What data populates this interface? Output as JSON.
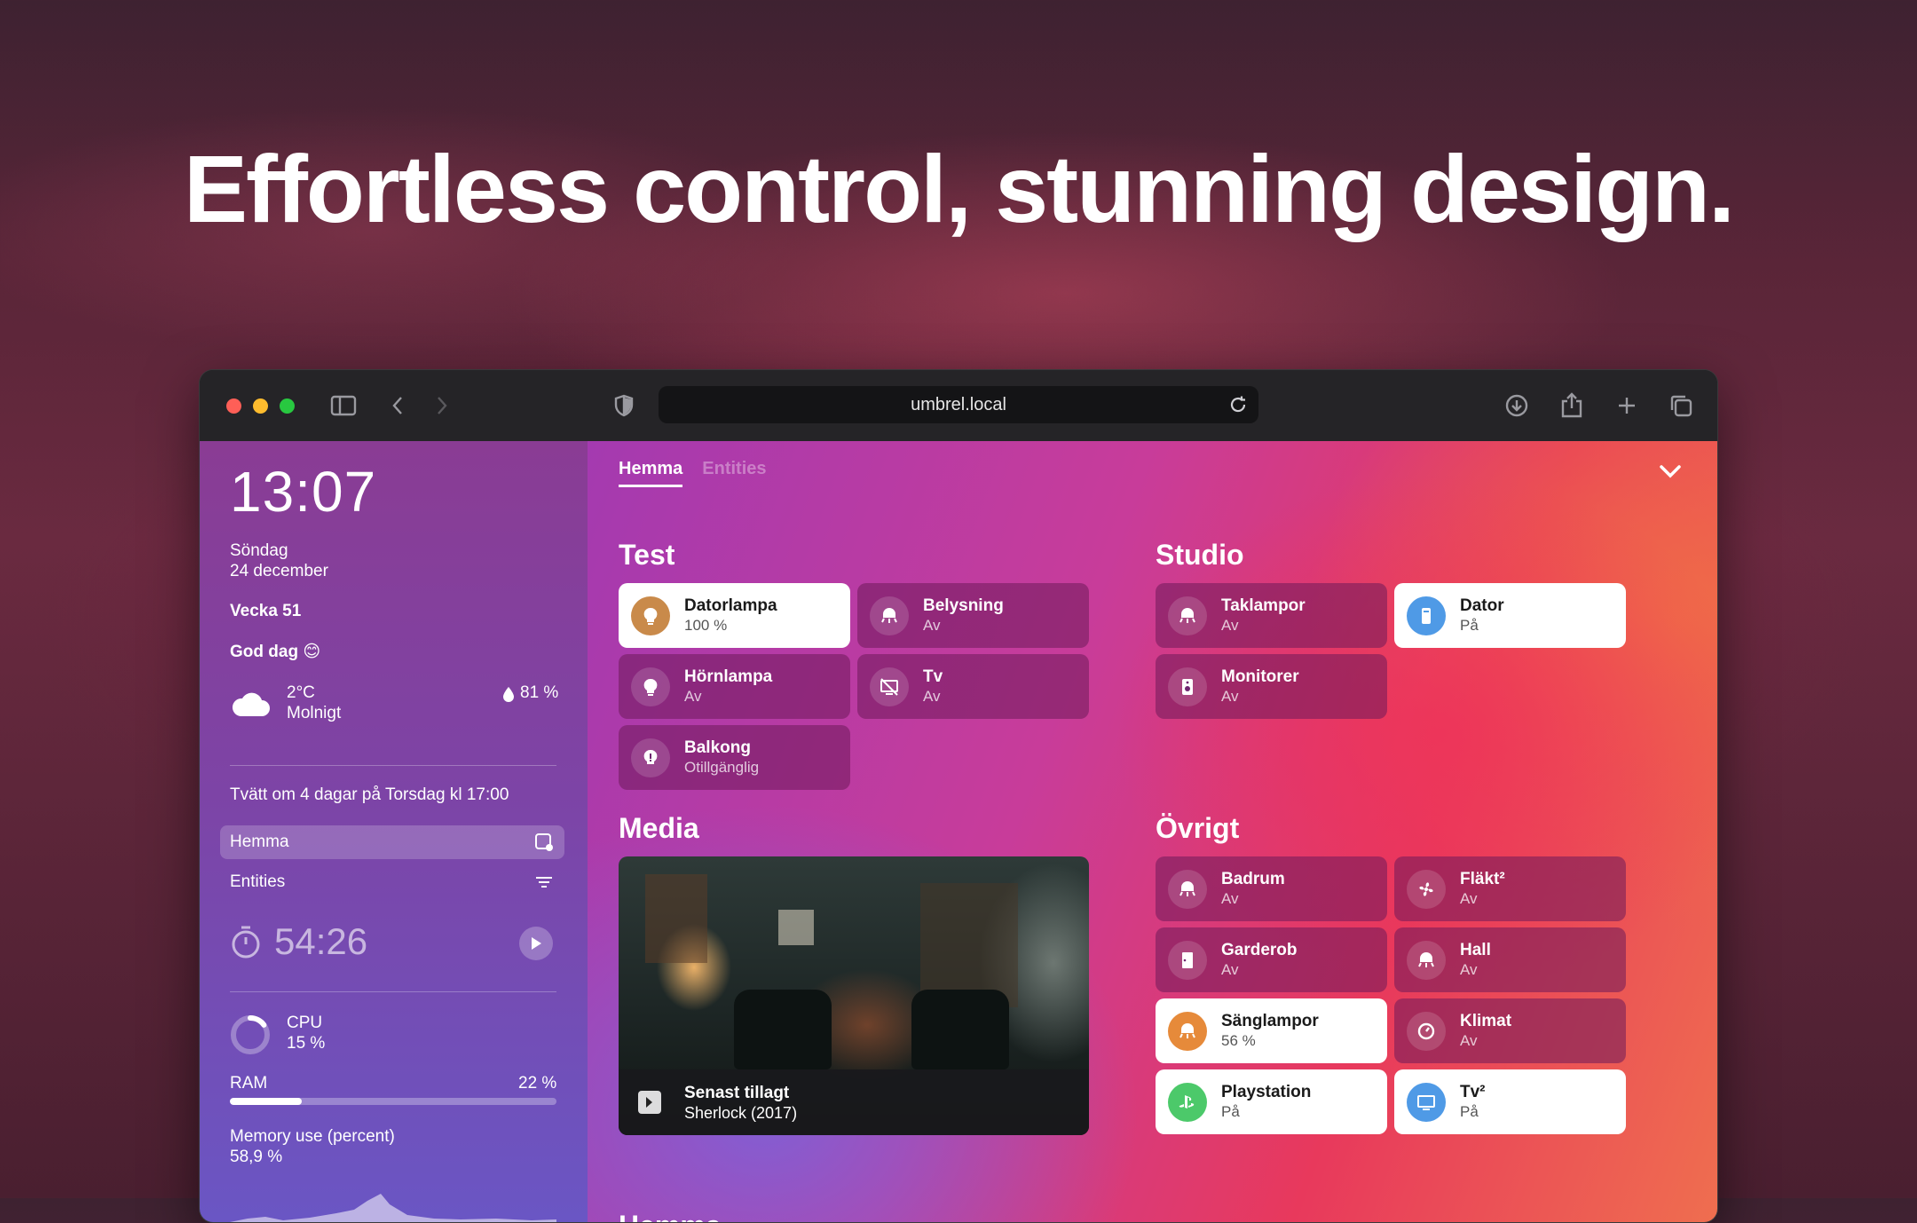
{
  "headline": "Effortless control, stunning design.",
  "browser": {
    "url": "umbrel.local"
  },
  "sidebar": {
    "time": "13:07",
    "weekday": "Söndag",
    "date": "24 december",
    "week": "Vecka 51",
    "greeting": "God dag 😊",
    "weather": {
      "temp": "2°C",
      "condition": "Molnigt",
      "humidity": "81 %"
    },
    "reminder": "Tvätt om 4 dagar på Torsdag kl 17:00",
    "nav": [
      {
        "label": "Hemma"
      },
      {
        "label": "Entities"
      }
    ],
    "timer": "54:26",
    "cpu": {
      "label": "CPU",
      "value": "15 %"
    },
    "ram": {
      "label": "RAM",
      "value": "22 %",
      "fraction": 0.22
    },
    "memory": {
      "label": "Memory use (percent)",
      "value": "58,9 %"
    }
  },
  "tabs": [
    {
      "label": "Hemma"
    },
    {
      "label": "Entities"
    }
  ],
  "sections": {
    "test": {
      "title": "Test",
      "cards": [
        {
          "name": "Datorlampa",
          "state": "100 %"
        },
        {
          "name": "Belysning",
          "state": "Av"
        },
        {
          "name": "Hörnlampa",
          "state": "Av"
        },
        {
          "name": "Tv",
          "state": "Av"
        },
        {
          "name": "Balkong",
          "state": "Otillgänglig"
        }
      ]
    },
    "studio": {
      "title": "Studio",
      "cards": [
        {
          "name": "Taklampor",
          "state": "Av"
        },
        {
          "name": "Dator",
          "state": "På"
        },
        {
          "name": "Monitorer",
          "state": "Av"
        }
      ]
    },
    "media": {
      "title": "Media",
      "caption_title": "Senast tillagt",
      "caption_subtitle": "Sherlock (2017)"
    },
    "ovrigt": {
      "title": "Övrigt",
      "cards": [
        {
          "name": "Badrum",
          "state": "Av"
        },
        {
          "name": "Fläkt²",
          "state": "Av"
        },
        {
          "name": "Garderob",
          "state": "Av"
        },
        {
          "name": "Hall",
          "state": "Av"
        },
        {
          "name": "Sänglampor",
          "state": "56 %"
        },
        {
          "name": "Klimat",
          "state": "Av"
        },
        {
          "name": "Playstation",
          "state": "På"
        },
        {
          "name": "Tv²",
          "state": "På"
        }
      ]
    },
    "hemma": {
      "title": "Hemma"
    }
  },
  "colors": {
    "accent_lamp": "#c98a4a",
    "accent_blue": "#4f9ae6",
    "accent_green": "#4cc96a",
    "accent_orange": "#e68a3a"
  }
}
